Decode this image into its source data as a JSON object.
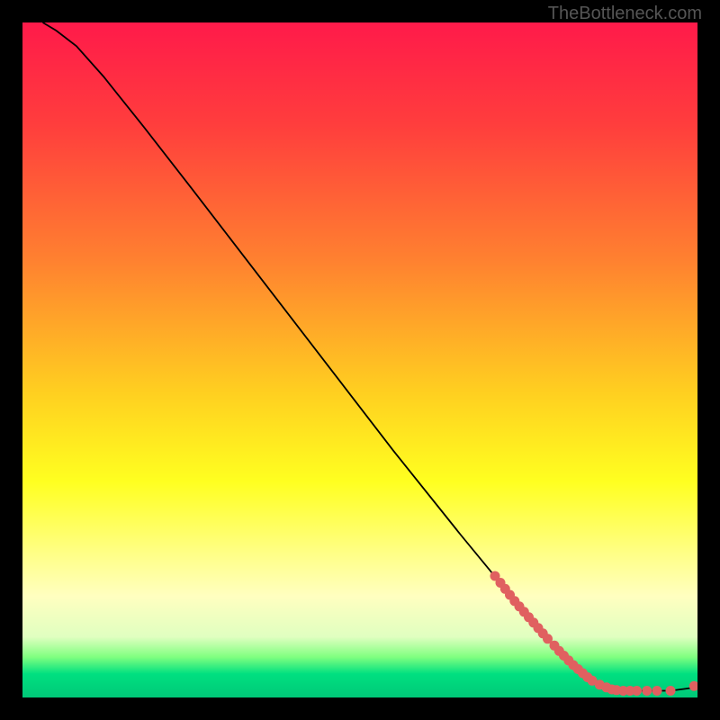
{
  "watermark": "TheBottleneck.com",
  "chart_data": {
    "type": "line",
    "title": "",
    "xlabel": "",
    "ylabel": "",
    "xlim": [
      0,
      100
    ],
    "ylim": [
      0,
      100
    ],
    "gradient_stops": [
      {
        "offset": 0,
        "color": "#ff1a4a"
      },
      {
        "offset": 15,
        "color": "#ff3d3d"
      },
      {
        "offset": 35,
        "color": "#ff8030"
      },
      {
        "offset": 55,
        "color": "#ffd020"
      },
      {
        "offset": 68,
        "color": "#ffff20"
      },
      {
        "offset": 78,
        "color": "#ffff80"
      },
      {
        "offset": 85,
        "color": "#ffffc0"
      },
      {
        "offset": 91,
        "color": "#e0ffc0"
      },
      {
        "offset": 94,
        "color": "#80ff80"
      },
      {
        "offset": 96.5,
        "color": "#00e080"
      },
      {
        "offset": 100,
        "color": "#00c878"
      }
    ],
    "curve": [
      {
        "x": 3.0,
        "y": 100.0
      },
      {
        "x": 5.0,
        "y": 98.8
      },
      {
        "x": 8.0,
        "y": 96.5
      },
      {
        "x": 12.0,
        "y": 92.0
      },
      {
        "x": 18.0,
        "y": 84.5
      },
      {
        "x": 25.0,
        "y": 75.5
      },
      {
        "x": 35.0,
        "y": 62.5
      },
      {
        "x": 45.0,
        "y": 49.5
      },
      {
        "x": 55.0,
        "y": 36.5
      },
      {
        "x": 65.0,
        "y": 24.0
      },
      {
        "x": 72.0,
        "y": 15.5
      },
      {
        "x": 78.0,
        "y": 8.5
      },
      {
        "x": 82.0,
        "y": 4.5
      },
      {
        "x": 85.0,
        "y": 2.2
      },
      {
        "x": 87.0,
        "y": 1.3
      },
      {
        "x": 90.0,
        "y": 1.0
      },
      {
        "x": 93.0,
        "y": 1.0
      },
      {
        "x": 96.0,
        "y": 1.0
      },
      {
        "x": 99.0,
        "y": 1.4
      },
      {
        "x": 100.0,
        "y": 1.8
      }
    ],
    "markers": [
      {
        "x": 70.0,
        "y": 18.0
      },
      {
        "x": 70.8,
        "y": 17.0
      },
      {
        "x": 71.5,
        "y": 16.1
      },
      {
        "x": 72.2,
        "y": 15.2
      },
      {
        "x": 72.9,
        "y": 14.3
      },
      {
        "x": 73.6,
        "y": 13.5
      },
      {
        "x": 74.3,
        "y": 12.7
      },
      {
        "x": 75.0,
        "y": 11.9
      },
      {
        "x": 75.7,
        "y": 11.1
      },
      {
        "x": 76.4,
        "y": 10.3
      },
      {
        "x": 77.1,
        "y": 9.5
      },
      {
        "x": 77.8,
        "y": 8.7
      },
      {
        "x": 78.8,
        "y": 7.7
      },
      {
        "x": 79.5,
        "y": 6.9
      },
      {
        "x": 80.2,
        "y": 6.2
      },
      {
        "x": 80.9,
        "y": 5.5
      },
      {
        "x": 81.6,
        "y": 4.8
      },
      {
        "x": 82.3,
        "y": 4.2
      },
      {
        "x": 83.0,
        "y": 3.6
      },
      {
        "x": 83.7,
        "y": 3.0
      },
      {
        "x": 84.4,
        "y": 2.5
      },
      {
        "x": 85.5,
        "y": 1.9
      },
      {
        "x": 86.5,
        "y": 1.5
      },
      {
        "x": 87.3,
        "y": 1.2
      },
      {
        "x": 88.0,
        "y": 1.1
      },
      {
        "x": 89.0,
        "y": 1.0
      },
      {
        "x": 90.0,
        "y": 1.0
      },
      {
        "x": 91.0,
        "y": 1.0
      },
      {
        "x": 92.5,
        "y": 1.0
      },
      {
        "x": 94.0,
        "y": 1.0
      },
      {
        "x": 96.0,
        "y": 1.0
      },
      {
        "x": 99.5,
        "y": 1.7
      }
    ],
    "marker_color": "#e06060",
    "marker_radius": 5.5
  }
}
